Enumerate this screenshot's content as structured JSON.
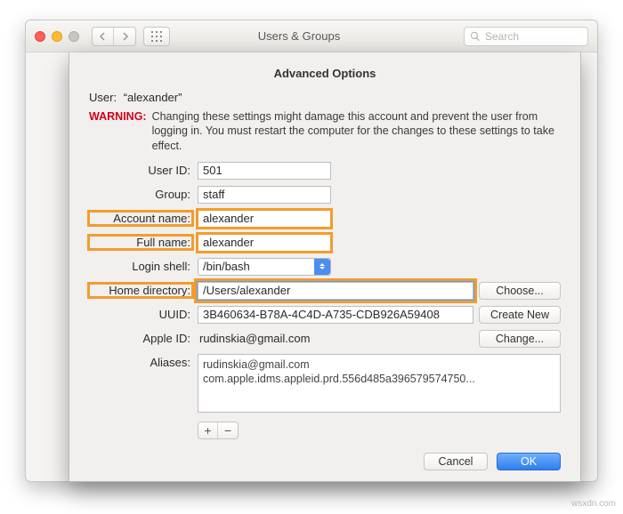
{
  "window": {
    "title": "Users & Groups",
    "search_placeholder": "Search"
  },
  "sheet": {
    "title": "Advanced Options",
    "user_label": "User:",
    "user_value": "“alexander”",
    "warning_label": "WARNING:",
    "warning_text": "Changing these settings might damage this account and prevent the user from logging in. You must restart the computer for the changes to these settings to take effect."
  },
  "fields": {
    "user_id": {
      "label": "User ID:",
      "value": "501"
    },
    "group": {
      "label": "Group:",
      "value": "staff"
    },
    "account_name": {
      "label": "Account name:",
      "value": "alexander"
    },
    "full_name": {
      "label": "Full name:",
      "value": "alexander"
    },
    "login_shell": {
      "label": "Login shell:",
      "value": "/bin/bash"
    },
    "home_dir": {
      "label": "Home directory:",
      "value": "/Users/alexander"
    },
    "uuid": {
      "label": "UUID:",
      "value": "3B460634-B78A-4C4D-A735-CDB926A59408"
    },
    "apple_id": {
      "label": "Apple ID:",
      "value": "rudinskia@gmail.com"
    },
    "aliases": {
      "label": "Aliases:",
      "value": "rudinskia@gmail.com\ncom.apple.idms.appleid.prd.556d485a396579574750..."
    }
  },
  "buttons": {
    "choose": "Choose...",
    "create_new": "Create New",
    "change": "Change...",
    "cancel": "Cancel",
    "ok": "OK",
    "plus": "+",
    "minus": "−"
  },
  "credit": "wsxdn.com"
}
